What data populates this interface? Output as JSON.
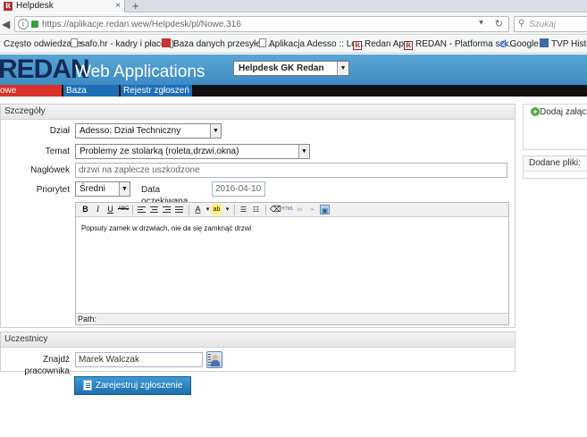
{
  "browser": {
    "tab_title": "Helpdesk",
    "tab_favicon": "R",
    "tab_close": "×",
    "new_tab": "+",
    "url": "https://aplikacje.redan.wew/Helpdesk/pl/Nowe,316",
    "search_placeholder": "Szukaj",
    "bookmarks": [
      {
        "label": "Często odwiedzane",
        "icon": "doc-icon"
      },
      {
        "label": "safo.hr - kadry i płace ()",
        "icon": "doc-icon"
      },
      {
        "label": "Baza danych przesyłek ...",
        "icon": "red-icon"
      },
      {
        "label": "Aplikacja Adesso :: Lo...",
        "icon": "doc-icon"
      },
      {
        "label": "Redan App",
        "icon": "redan-icon"
      },
      {
        "label": "REDAN - Platforma szk...",
        "icon": "redan-icon"
      },
      {
        "label": "Google",
        "icon": "google-icon"
      },
      {
        "label": "TVP Histor",
        "icon": "tvp-icon"
      }
    ]
  },
  "app": {
    "logo_bold": "REDAN",
    "logo_light": "Web Applications",
    "app_select": "Helpdesk GK Redan"
  },
  "menu": {
    "new": "owe zgłoszenie",
    "knowledge": "Baza wiedzy",
    "register": "Rejestr zgłoszeń"
  },
  "details": {
    "title": "Szczegóły",
    "dzial_label": "Dział",
    "dzial_value": "Adesso: Dział Techniczny",
    "temat_label": "Temat",
    "temat_value": "Problemy ze stolarką (roleta,drzwi,okna)",
    "naglowek_label": "Nagłówek",
    "naglowek_value": "drzwi na zaplecze uszkodzone",
    "priorytet_label": "Priorytet",
    "priorytet_value": "Średni",
    "data_label": "Data oczekiwana",
    "data_value": "2016-04-10",
    "editor_text": "Popsuty zamek w drzwiach, nie da się zamknąć drzwi",
    "editor_path": "Path:"
  },
  "participants": {
    "title": "Uczestnicy",
    "find_label": "Znajdź pracownika",
    "find_value": "Marek Walczak"
  },
  "submit_label": "Zarejestruj zgłoszenie",
  "attachments": {
    "add_label": "Dodaj załączn",
    "files_label": "Dodane pliki:"
  }
}
